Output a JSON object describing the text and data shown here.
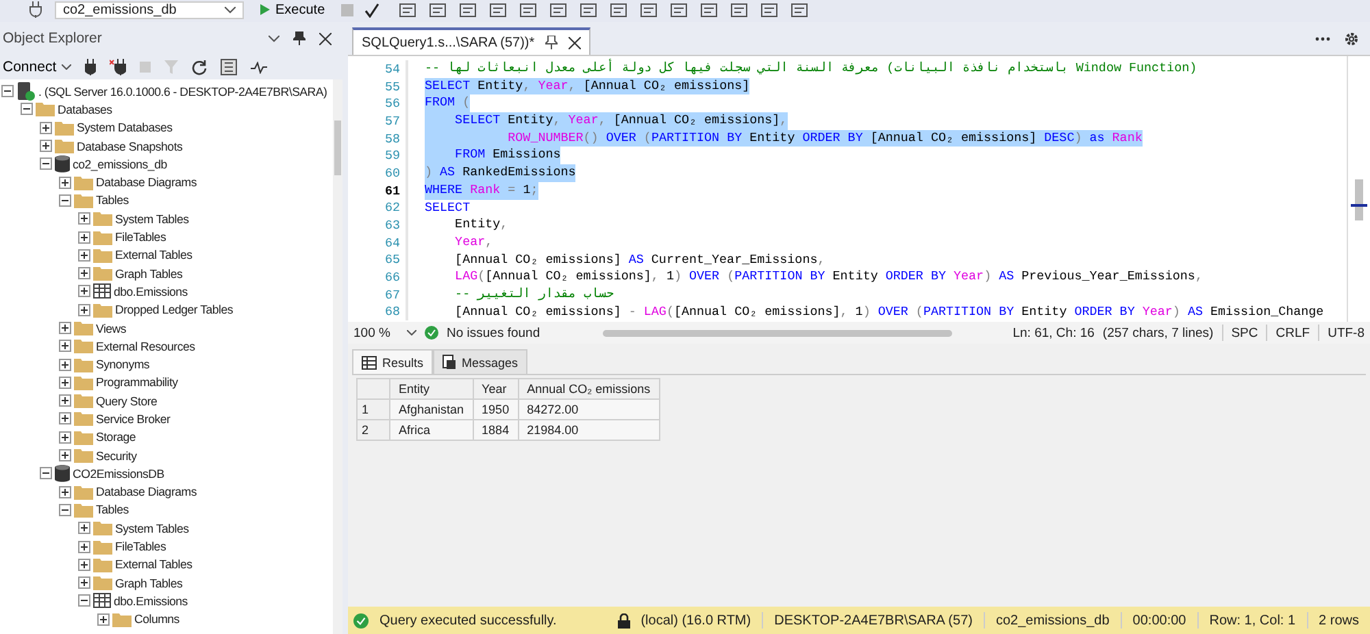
{
  "toolbar": {
    "database": "co2_emissions_db",
    "execute_label": "Execute"
  },
  "object_explorer": {
    "title": "Object Explorer",
    "connect_label": "Connect",
    "tree": [
      {
        "label": ". (SQL Server 16.0.1000.6 - DESKTOP-2A4E7BR\\SARA)",
        "kind": "server",
        "expanded": true,
        "children": [
          {
            "label": "Databases",
            "kind": "folder",
            "expanded": true,
            "children": [
              {
                "label": "System Databases",
                "kind": "folder",
                "expanded": false
              },
              {
                "label": "Database Snapshots",
                "kind": "folder",
                "expanded": false
              },
              {
                "label": "co2_emissions_db",
                "kind": "database",
                "expanded": true,
                "children": [
                  {
                    "label": "Database Diagrams",
                    "kind": "folder",
                    "expanded": false
                  },
                  {
                    "label": "Tables",
                    "kind": "folder",
                    "expanded": true,
                    "children": [
                      {
                        "label": "System Tables",
                        "kind": "folder",
                        "expanded": false
                      },
                      {
                        "label": "FileTables",
                        "kind": "folder",
                        "expanded": false
                      },
                      {
                        "label": "External Tables",
                        "kind": "folder",
                        "expanded": false
                      },
                      {
                        "label": "Graph Tables",
                        "kind": "folder",
                        "expanded": false
                      },
                      {
                        "label": "dbo.Emissions",
                        "kind": "table",
                        "expanded": false
                      },
                      {
                        "label": "Dropped Ledger Tables",
                        "kind": "folder",
                        "expanded": false
                      }
                    ]
                  },
                  {
                    "label": "Views",
                    "kind": "folder",
                    "expanded": false
                  },
                  {
                    "label": "External Resources",
                    "kind": "folder",
                    "expanded": false
                  },
                  {
                    "label": "Synonyms",
                    "kind": "folder",
                    "expanded": false
                  },
                  {
                    "label": "Programmability",
                    "kind": "folder",
                    "expanded": false
                  },
                  {
                    "label": "Query Store",
                    "kind": "folder",
                    "expanded": false
                  },
                  {
                    "label": "Service Broker",
                    "kind": "folder",
                    "expanded": false
                  },
                  {
                    "label": "Storage",
                    "kind": "folder",
                    "expanded": false
                  },
                  {
                    "label": "Security",
                    "kind": "folder",
                    "expanded": false
                  }
                ]
              },
              {
                "label": "CO2EmissionsDB",
                "kind": "database",
                "expanded": true,
                "children": [
                  {
                    "label": "Database Diagrams",
                    "kind": "folder",
                    "expanded": false
                  },
                  {
                    "label": "Tables",
                    "kind": "folder",
                    "expanded": true,
                    "children": [
                      {
                        "label": "System Tables",
                        "kind": "folder",
                        "expanded": false
                      },
                      {
                        "label": "FileTables",
                        "kind": "folder",
                        "expanded": false
                      },
                      {
                        "label": "External Tables",
                        "kind": "folder",
                        "expanded": false
                      },
                      {
                        "label": "Graph Tables",
                        "kind": "folder",
                        "expanded": false
                      },
                      {
                        "label": "dbo.Emissions",
                        "kind": "table",
                        "expanded": true,
                        "children": [
                          {
                            "label": "Columns",
                            "kind": "folder",
                            "expanded": false
                          }
                        ]
                      }
                    ]
                  }
                ]
              }
            ]
          }
        ]
      }
    ]
  },
  "editor": {
    "tab": {
      "title": "SQLQuery1.s...\\SARA (57))*",
      "selected": true
    },
    "lines": [
      {
        "number": "54",
        "selected": false,
        "current": false,
        "tokens": [
          {
            "kind": "comment",
            "text": "-- معرفة السنة التي سجلت فيها كل دولة أعلى معدل انبعاثات لها (باستخدام نافذة البيانات Window Function)"
          }
        ]
      },
      {
        "number": "55",
        "selected": true,
        "current": false,
        "tokens": [
          {
            "kind": "kw",
            "text": "SELECT"
          },
          {
            "kind": "id",
            "text": " Entity"
          },
          {
            "kind": "op",
            "text": ", "
          },
          {
            "kind": "fn",
            "text": "Year"
          },
          {
            "kind": "op",
            "text": ", "
          },
          {
            "kind": "id",
            "text": "[Annual CO₂ emissions]"
          }
        ]
      },
      {
        "number": "56",
        "selected": true,
        "current": false,
        "tokens": [
          {
            "kind": "kw",
            "text": "FROM"
          },
          {
            "kind": "op",
            "text": " ("
          }
        ]
      },
      {
        "number": "57",
        "selected": true,
        "current": false,
        "tokens": [
          {
            "kind": "kw",
            "text": "    SELECT"
          },
          {
            "kind": "id",
            "text": " Entity"
          },
          {
            "kind": "op",
            "text": ", "
          },
          {
            "kind": "fn",
            "text": "Year"
          },
          {
            "kind": "op",
            "text": ", "
          },
          {
            "kind": "id",
            "text": "[Annual CO₂ emissions]"
          },
          {
            "kind": "op",
            "text": ","
          }
        ]
      },
      {
        "number": "58",
        "selected": true,
        "current": false,
        "tokens": [
          {
            "kind": "fn",
            "text": "           ROW_NUMBER"
          },
          {
            "kind": "op",
            "text": "() "
          },
          {
            "kind": "kw",
            "text": "OVER"
          },
          {
            "kind": "op",
            "text": " ("
          },
          {
            "kind": "kw",
            "text": "PARTITION BY"
          },
          {
            "kind": "id",
            "text": " Entity "
          },
          {
            "kind": "kw",
            "text": "ORDER BY"
          },
          {
            "kind": "id",
            "text": " [Annual CO₂ emissions] "
          },
          {
            "kind": "kw",
            "text": "DESC"
          },
          {
            "kind": "op",
            "text": ") "
          },
          {
            "kind": "kw",
            "text": "as"
          },
          {
            "kind": "fn",
            "text": " Rank"
          }
        ]
      },
      {
        "number": "59",
        "selected": true,
        "current": false,
        "tokens": [
          {
            "kind": "kw",
            "text": "    FROM"
          },
          {
            "kind": "id",
            "text": " Emissions"
          }
        ]
      },
      {
        "number": "60",
        "selected": true,
        "current": false,
        "tokens": [
          {
            "kind": "op",
            "text": ") "
          },
          {
            "kind": "kw",
            "text": "AS"
          },
          {
            "kind": "id",
            "text": " RankedEmissions"
          }
        ]
      },
      {
        "number": "61",
        "selected": true,
        "current": true,
        "tokens": [
          {
            "kind": "kw",
            "text": "WHERE"
          },
          {
            "kind": "fn",
            "text": " Rank"
          },
          {
            "kind": "op",
            "text": " = "
          },
          {
            "kind": "id",
            "text": "1"
          },
          {
            "kind": "op",
            "text": ";"
          }
        ]
      },
      {
        "number": "62",
        "selected": false,
        "current": false,
        "tokens": [
          {
            "kind": "kw",
            "text": "SELECT"
          }
        ]
      },
      {
        "number": "63",
        "selected": false,
        "current": false,
        "tokens": [
          {
            "kind": "id",
            "text": "    Entity"
          },
          {
            "kind": "op",
            "text": ","
          }
        ]
      },
      {
        "number": "64",
        "selected": false,
        "current": false,
        "tokens": [
          {
            "kind": "fn",
            "text": "    Year"
          },
          {
            "kind": "op",
            "text": ","
          }
        ]
      },
      {
        "number": "65",
        "selected": false,
        "current": false,
        "tokens": [
          {
            "kind": "id",
            "text": "    [Annual CO₂ emissions] "
          },
          {
            "kind": "kw",
            "text": "AS"
          },
          {
            "kind": "id",
            "text": " Current_Year_Emissions"
          },
          {
            "kind": "op",
            "text": ","
          }
        ]
      },
      {
        "number": "66",
        "selected": false,
        "current": false,
        "tokens": [
          {
            "kind": "fn",
            "text": "    LAG"
          },
          {
            "kind": "op",
            "text": "("
          },
          {
            "kind": "id",
            "text": "[Annual CO₂ emissions]"
          },
          {
            "kind": "op",
            "text": ", "
          },
          {
            "kind": "id",
            "text": "1"
          },
          {
            "kind": "op",
            "text": ") "
          },
          {
            "kind": "kw",
            "text": "OVER"
          },
          {
            "kind": "op",
            "text": " ("
          },
          {
            "kind": "kw",
            "text": "PARTITION BY"
          },
          {
            "kind": "id",
            "text": " Entity "
          },
          {
            "kind": "kw",
            "text": "ORDER BY"
          },
          {
            "kind": "fn",
            "text": " Year"
          },
          {
            "kind": "op",
            "text": ") "
          },
          {
            "kind": "kw",
            "text": "AS"
          },
          {
            "kind": "id",
            "text": " Previous_Year_Emissions"
          },
          {
            "kind": "op",
            "text": ","
          }
        ]
      },
      {
        "number": "67",
        "selected": false,
        "current": false,
        "tokens": [
          {
            "kind": "comment",
            "text": "    -- حساب مقدار التغيير"
          }
        ]
      },
      {
        "number": "68",
        "selected": false,
        "current": false,
        "tokens": [
          {
            "kind": "id",
            "text": "    [Annual CO₂ emissions] "
          },
          {
            "kind": "op",
            "text": "- "
          },
          {
            "kind": "fn",
            "text": "LAG"
          },
          {
            "kind": "op",
            "text": "("
          },
          {
            "kind": "id",
            "text": "[Annual CO₂ emissions]"
          },
          {
            "kind": "op",
            "text": ", "
          },
          {
            "kind": "id",
            "text": "1"
          },
          {
            "kind": "op",
            "text": ") "
          },
          {
            "kind": "kw",
            "text": "OVER"
          },
          {
            "kind": "op",
            "text": " ("
          },
          {
            "kind": "kw",
            "text": "PARTITION BY"
          },
          {
            "kind": "id",
            "text": " Entity "
          },
          {
            "kind": "kw",
            "text": "ORDER BY"
          },
          {
            "kind": "fn",
            "text": " Year"
          },
          {
            "kind": "op",
            "text": ") "
          },
          {
            "kind": "kw",
            "text": "AS"
          },
          {
            "kind": "id",
            "text": " Emission_Change"
          }
        ]
      }
    ]
  },
  "editor_status": {
    "zoom": "100 %",
    "issues": "No issues found",
    "position": "Ln: 61, Ch: 16",
    "selection_info": "(257 chars, 7 lines)",
    "indent": "SPC",
    "line_ending": "CRLF",
    "encoding": "UTF-8"
  },
  "results": {
    "tabs": [
      {
        "label": "Results",
        "kind": "grid",
        "selected": true
      },
      {
        "label": "Messages",
        "kind": "messages",
        "selected": false
      }
    ],
    "columns": [
      "Entity",
      "Year",
      "Annual CO₂ emissions"
    ],
    "rows": [
      {
        "number": "1",
        "cells": [
          "Afghanistan",
          "1950",
          "84272.00"
        ]
      },
      {
        "number": "2",
        "cells": [
          "Africa",
          "1884",
          "21984.00"
        ]
      }
    ]
  },
  "status_bar": {
    "message": "Query executed successfully.",
    "items": [
      "(local) (16.0 RTM)",
      "DESKTOP-2A4E7BR\\SARA (57)",
      "co2_emissions_db",
      "00:00:00",
      "Row: 1, Col: 1",
      "2 rows"
    ]
  }
}
